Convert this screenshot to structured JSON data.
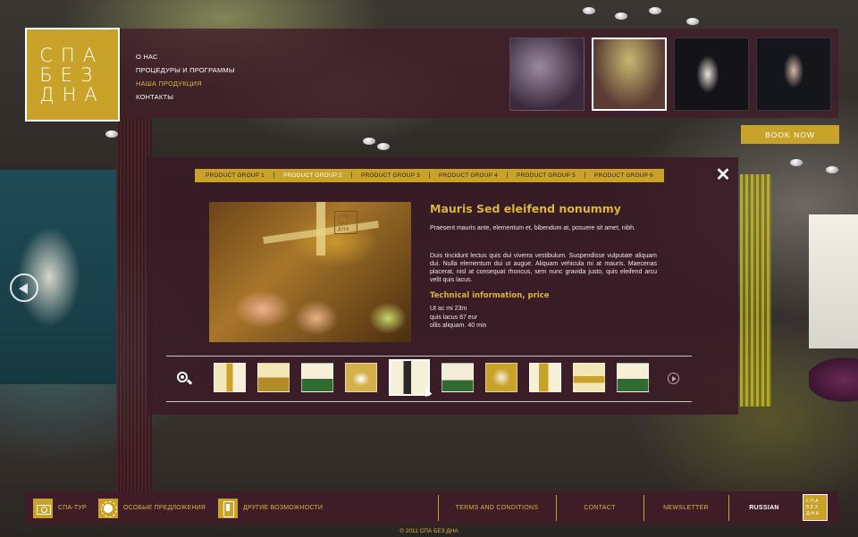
{
  "logo": {
    "lines": [
      "СПА",
      "БЕЗ",
      "ДНА"
    ]
  },
  "nav": {
    "items": [
      {
        "label": "О НАС"
      },
      {
        "label": "ПРОЦЕДУРЫ И ПРОГРАММЫ"
      },
      {
        "label": "НАША ПРОДУКЦИЯ"
      },
      {
        "label": "КОНТАКТЫ"
      }
    ]
  },
  "book_now": "BOOK NOW",
  "tabs": [
    {
      "label": "PRODUCT GROUP 1"
    },
    {
      "label": "PRODUCT GROUP 2"
    },
    {
      "label": "PRODUCT GROUP 3"
    },
    {
      "label": "PRODUCT GROUP 4"
    },
    {
      "label": "PRODUCT GROUP 5"
    },
    {
      "label": "PRODUCT GROUP 6"
    }
  ],
  "tab_separator": "|",
  "close_glyph": "✕",
  "product": {
    "mini_logo": "СПА БЕЗ ДНА",
    "title": "Mauris Sed eleifend nonummy",
    "desc1": "Praesent mauris ante, elementum et, bibendum at, posuere sit amet, nibh.",
    "desc2": "Duis tincidunt lectus quis dui viverra vestibulum. Suspendisse vulputate aliquam dui. Nulla elementum dui ut augue. Aliquam vehicula mi at mauris. Maecenas placerat, nisl at consequat rhoncus, sem nunc gravida justo, quis eleifend arcu velit quis lacus.",
    "tech_title": "Technical information, price",
    "tech_lines": [
      "Ut ac mi   23m",
      "quis lacus  87 eur",
      "ollis aliquam.  40 min"
    ]
  },
  "footer": {
    "items": [
      {
        "label": "СПА-ТУР",
        "icon": "camera-icon"
      },
      {
        "label": "ОСОБЫЕ ПРЕДЛОЖЕНИЯ",
        "icon": "sun-icon"
      },
      {
        "label": "ДРУГИЕ ВОЗМОЖНОСТИ",
        "icon": "tablet-icon"
      }
    ],
    "links": [
      {
        "label": "TERMS AND CONDITIONS"
      },
      {
        "label": "CONTACT"
      },
      {
        "label": "NEWSLETTER"
      },
      {
        "label": "RUSSIAN"
      }
    ],
    "logo_text": "СПА БЕЗ ДНА",
    "copyright": "© 2011 СПА БЕЗ ДНА"
  },
  "colors": {
    "gold": "#c9a22a",
    "gold_text": "#d9b63c",
    "panel": "#3a1a26"
  }
}
